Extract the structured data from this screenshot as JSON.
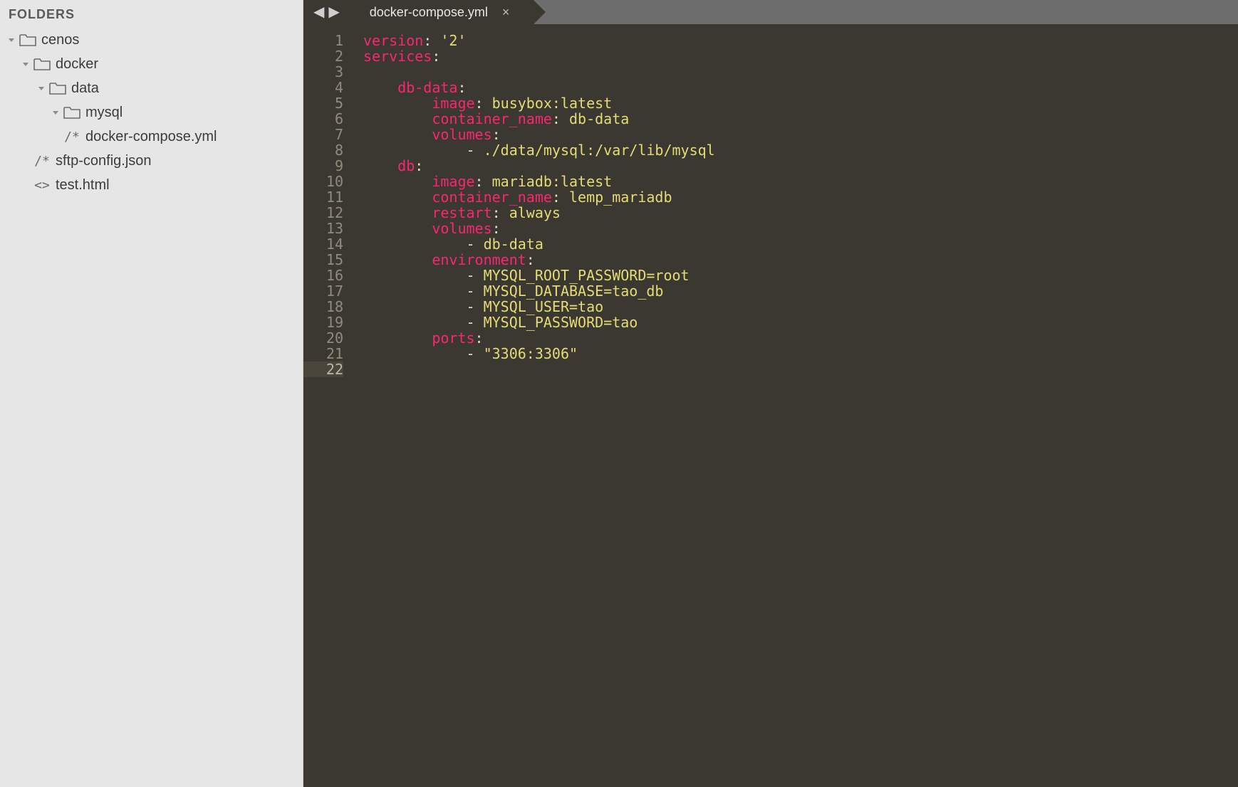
{
  "sidebar": {
    "header": "FOLDERS",
    "tree": [
      {
        "name": "cenos",
        "kind": "folder",
        "expanded": true,
        "depth": 0
      },
      {
        "name": "docker",
        "kind": "folder",
        "expanded": true,
        "depth": 1
      },
      {
        "name": "data",
        "kind": "folder",
        "expanded": true,
        "depth": 2
      },
      {
        "name": "mysql",
        "kind": "folder",
        "expanded": true,
        "depth": 3
      },
      {
        "name": "docker-compose.yml",
        "kind": "file",
        "glyph": "/*",
        "depth": 3
      },
      {
        "name": "sftp-config.json",
        "kind": "file",
        "glyph": "/*",
        "depth": 1
      },
      {
        "name": "test.html",
        "kind": "file",
        "glyph": "<>",
        "depth": 1
      }
    ]
  },
  "tabs": {
    "nav_back": "◀",
    "nav_fwd": "▶",
    "active": {
      "title": "docker-compose.yml",
      "close": "×"
    }
  },
  "editor": {
    "line_count": 22,
    "current_line": 22,
    "tokens": [
      [
        {
          "c": "tk-key",
          "t": "version"
        },
        {
          "c": "tk-punc",
          "t": ": "
        },
        {
          "c": "tk-str",
          "t": "'2'"
        }
      ],
      [
        {
          "c": "tk-key",
          "t": "services"
        },
        {
          "c": "tk-punc",
          "t": ":"
        }
      ],
      [],
      [
        {
          "c": "tk-punc",
          "t": "    "
        },
        {
          "c": "tk-key",
          "t": "db-data"
        },
        {
          "c": "tk-punc",
          "t": ":"
        }
      ],
      [
        {
          "c": "tk-punc",
          "t": "        "
        },
        {
          "c": "tk-key",
          "t": "image"
        },
        {
          "c": "tk-punc",
          "t": ": "
        },
        {
          "c": "tk-str",
          "t": "busybox:latest"
        }
      ],
      [
        {
          "c": "tk-punc",
          "t": "        "
        },
        {
          "c": "tk-key",
          "t": "container_name"
        },
        {
          "c": "tk-punc",
          "t": ": "
        },
        {
          "c": "tk-str",
          "t": "db-data"
        }
      ],
      [
        {
          "c": "tk-punc",
          "t": "        "
        },
        {
          "c": "tk-key",
          "t": "volumes"
        },
        {
          "c": "tk-punc",
          "t": ":"
        }
      ],
      [
        {
          "c": "tk-punc",
          "t": "            "
        },
        {
          "c": "tk-dash",
          "t": "- "
        },
        {
          "c": "tk-str",
          "t": "./data/mysql:/var/lib/mysql"
        }
      ],
      [
        {
          "c": "tk-punc",
          "t": "    "
        },
        {
          "c": "tk-key",
          "t": "db"
        },
        {
          "c": "tk-punc",
          "t": ":"
        }
      ],
      [
        {
          "c": "tk-punc",
          "t": "        "
        },
        {
          "c": "tk-key",
          "t": "image"
        },
        {
          "c": "tk-punc",
          "t": ": "
        },
        {
          "c": "tk-str",
          "t": "mariadb:latest"
        }
      ],
      [
        {
          "c": "tk-punc",
          "t": "        "
        },
        {
          "c": "tk-key",
          "t": "container_name"
        },
        {
          "c": "tk-punc",
          "t": ": "
        },
        {
          "c": "tk-str",
          "t": "lemp_mariadb"
        }
      ],
      [
        {
          "c": "tk-punc",
          "t": "        "
        },
        {
          "c": "tk-key",
          "t": "restart"
        },
        {
          "c": "tk-punc",
          "t": ": "
        },
        {
          "c": "tk-str",
          "t": "always"
        }
      ],
      [
        {
          "c": "tk-punc",
          "t": "        "
        },
        {
          "c": "tk-key",
          "t": "volumes"
        },
        {
          "c": "tk-punc",
          "t": ":"
        }
      ],
      [
        {
          "c": "tk-punc",
          "t": "            "
        },
        {
          "c": "tk-dash",
          "t": "- "
        },
        {
          "c": "tk-str",
          "t": "db-data"
        }
      ],
      [
        {
          "c": "tk-punc",
          "t": "        "
        },
        {
          "c": "tk-key",
          "t": "environment"
        },
        {
          "c": "tk-punc",
          "t": ":"
        }
      ],
      [
        {
          "c": "tk-punc",
          "t": "            "
        },
        {
          "c": "tk-dash",
          "t": "- "
        },
        {
          "c": "tk-str",
          "t": "MYSQL_ROOT_PASSWORD=root"
        }
      ],
      [
        {
          "c": "tk-punc",
          "t": "            "
        },
        {
          "c": "tk-dash",
          "t": "- "
        },
        {
          "c": "tk-str",
          "t": "MYSQL_DATABASE=tao_db"
        }
      ],
      [
        {
          "c": "tk-punc",
          "t": "            "
        },
        {
          "c": "tk-dash",
          "t": "- "
        },
        {
          "c": "tk-str",
          "t": "MYSQL_USER=tao"
        }
      ],
      [
        {
          "c": "tk-punc",
          "t": "            "
        },
        {
          "c": "tk-dash",
          "t": "- "
        },
        {
          "c": "tk-str",
          "t": "MYSQL_PASSWORD=tao"
        }
      ],
      [
        {
          "c": "tk-punc",
          "t": "        "
        },
        {
          "c": "tk-key",
          "t": "ports"
        },
        {
          "c": "tk-punc",
          "t": ":"
        }
      ],
      [
        {
          "c": "tk-punc",
          "t": "            "
        },
        {
          "c": "tk-dash",
          "t": "- "
        },
        {
          "c": "tk-str",
          "t": "\"3306:3306\""
        }
      ],
      []
    ]
  }
}
